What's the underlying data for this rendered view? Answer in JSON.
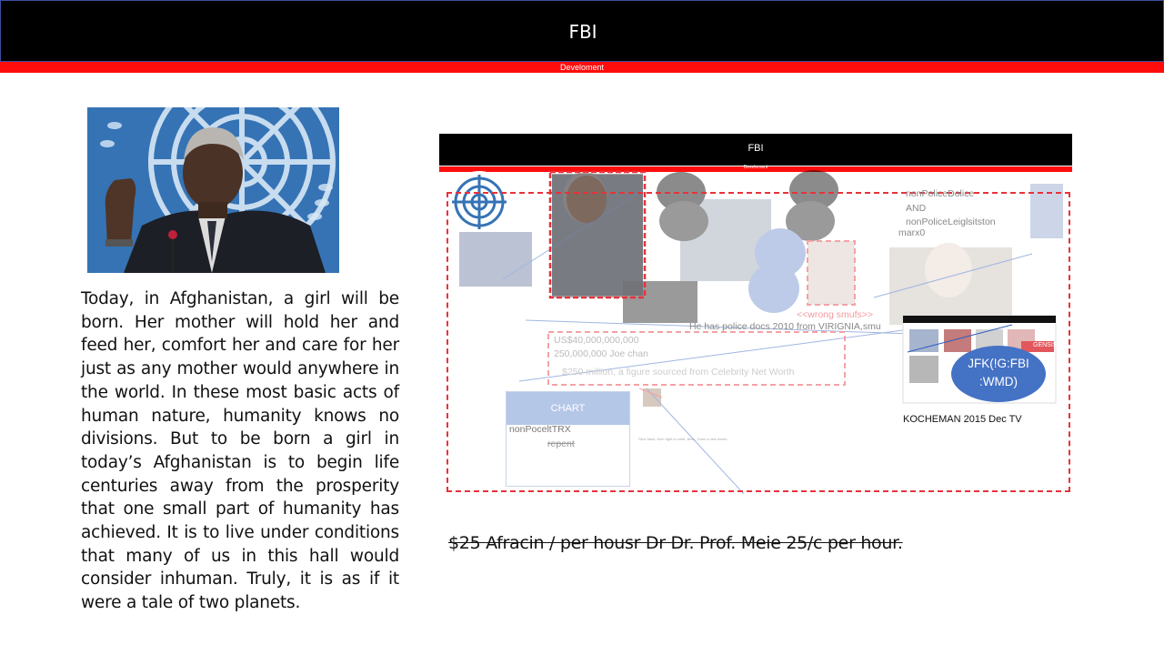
{
  "header": {
    "title": "FBI",
    "subtitle": "Develoment"
  },
  "portrait": {
    "icon": "un-speaker-photo"
  },
  "speech": {
    "text": "Today, in Afghanistan, a girl will be born. Her mother will hold her and feed her, comfort her and care for her just as any mother would anywhere in the world. In these most basic acts of human nature, humanity knows no divisions. But to be born a girl in today’s Afghanistan is to begin life centuries away from the prosperity that one small part of humanity has achieved. It is to live under conditions that many of us in this hall would consider inhuman. Truly, it is as if it were a tale of two planets."
  },
  "embedded_slide": {
    "title": "FBI",
    "subtitle": "Develoment",
    "texts": {
      "police_top": "nonPoliceDolice",
      "and": "AND",
      "police_legis": "nonPoliceLeiglsitston",
      "marx": "marx0",
      "wrong": "<<wrong smufs>>",
      "police_docs": "He has police docs 2010 from VIRIGNIA,smu",
      "amount1": "US$40,000,000,000",
      "amount2": "250,000,000 Joe chan",
      "amount3": "$250 million, a figure sourced from Celebrity Net Worth",
      "chart": "CHART",
      "chart_item1": "nonPoceltTRX",
      "chart_item2": "repent",
      "tiny_caption": "Slice back, from right to write, Bells, Goes a new womb",
      "jfk": "JFK(!G:FBI :WMD)",
      "kocheman": "KOCHEMAN 2015 Dec TV",
      "gensis": "GENSIS"
    }
  },
  "footer": {
    "strike_text": "$25 Afracin / per housr Dr Dr. Prof. Meie 25/c per hour."
  },
  "colors": {
    "header_bg": "#000000",
    "accent_red": "#ff0d0d",
    "un_blue": "#2f6fb0",
    "bubble_blue": "#4472c4",
    "light_blue": "#b4c7e7"
  }
}
